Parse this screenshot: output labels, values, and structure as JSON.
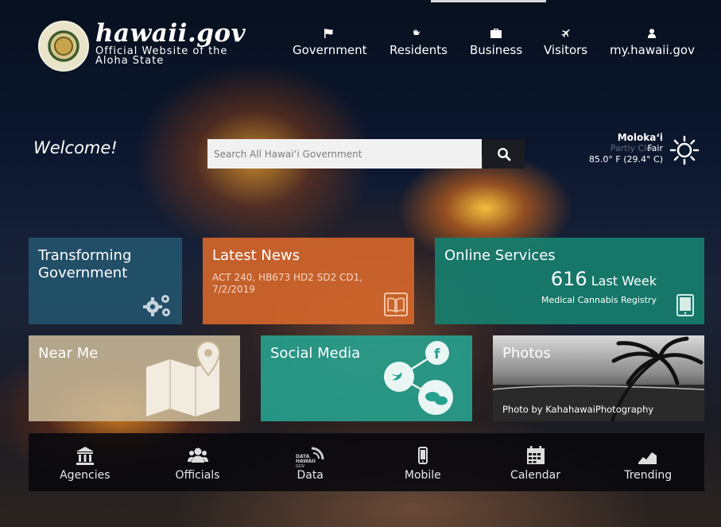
{
  "header": {
    "brand_title": "hawaii.gov",
    "brand_subtitle_line1": "Official Website of the",
    "brand_subtitle_line2": "Aloha State"
  },
  "nav": [
    {
      "label": "Government",
      "icon": "flag-icon"
    },
    {
      "label": "Residents",
      "icon": "hand-icon"
    },
    {
      "label": "Business",
      "icon": "briefcase-icon"
    },
    {
      "label": "Visitors",
      "icon": "airplane-icon"
    },
    {
      "label": "my.hawaii.gov",
      "icon": "user-icon"
    }
  ],
  "welcome": "Welcome!",
  "search": {
    "placeholder": "Search All Hawaiʻi Government"
  },
  "weather": {
    "location": "Molokaʻi",
    "condition_prev": "Partly Clo",
    "condition": "Fair",
    "temperature": "85.0° F (29.4° C)"
  },
  "tiles": {
    "transforming": "Transforming Government",
    "news_title": "Latest News",
    "news_text": "ACT 240, HB673 HD2 SD2 CD1, 7/2/2019",
    "online_title": "Online Services",
    "online_count": "616",
    "online_period": "Last Week",
    "online_sub": "Medical Cannabis Registry",
    "nearme_title": "Near Me",
    "social_title": "Social Media",
    "photos_title": "Photos",
    "photos_credit": "Photo by KahahawaiPhotography"
  },
  "footer": [
    {
      "label": "Agencies",
      "icon": "building-icon"
    },
    {
      "label": "Officials",
      "icon": "people-icon"
    },
    {
      "label": "Data",
      "icon": "data-hawaii-icon"
    },
    {
      "label": "Mobile",
      "icon": "mobile-icon"
    },
    {
      "label": "Calendar",
      "icon": "calendar-icon"
    },
    {
      "label": "Trending",
      "icon": "trending-icon"
    }
  ],
  "colors": {
    "tile_blue": "#24536c",
    "tile_orange": "#d6672b",
    "tile_teal": "#177e6d",
    "tile_social": "#27a18f"
  }
}
